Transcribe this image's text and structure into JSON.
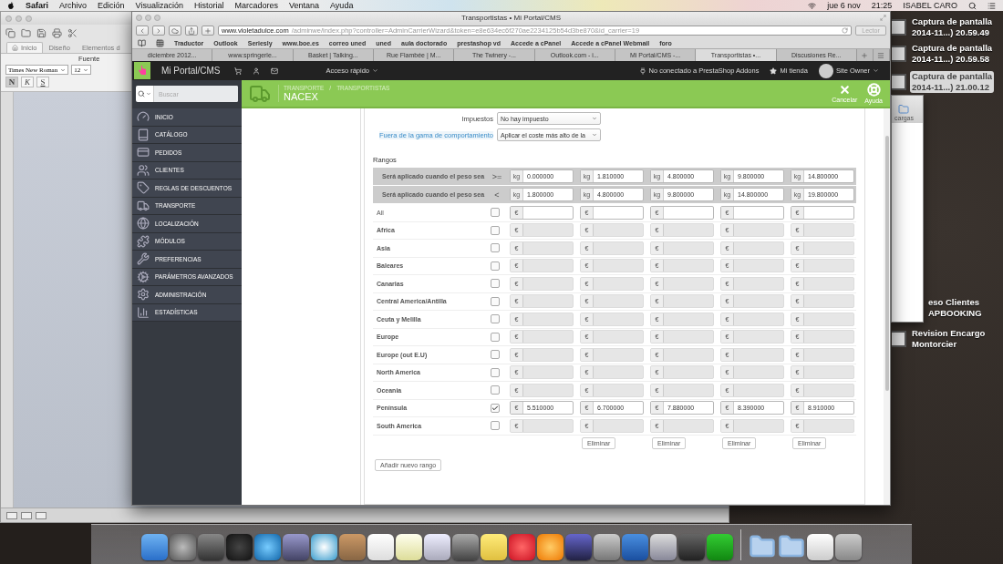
{
  "menubar": {
    "menus": [
      "Safari",
      "Archivo",
      "Edición",
      "Visualización",
      "Historial",
      "Marcadores",
      "Ventana",
      "Ayuda"
    ],
    "date": "jue 6 nov",
    "time": "21:25",
    "user": "ISABEL CARO"
  },
  "word_window": {
    "tabs": [
      {
        "label": "Inicio",
        "selected": true
      },
      {
        "label": "Diseño",
        "selected": false
      },
      {
        "label": "Elementos d",
        "selected": false
      }
    ],
    "group": "Fuente",
    "font": "Times New Roman",
    "size": "12",
    "styles": [
      "N",
      "K",
      "S"
    ]
  },
  "desktop_files": [
    {
      "name": "Captura de pantalla",
      "detail": "2014-11...) 20.59.49",
      "selected": false
    },
    {
      "name": "Captura de pantalla",
      "detail": "2014-11...) 20.59.58",
      "selected": false
    },
    {
      "name": "Captura de pantalla",
      "detail": "2014-11...) 21.00.12",
      "selected": true
    },
    {
      "name": "eso Clientes",
      "detail": "APBOOKING",
      "selected": false
    },
    {
      "name": "Revision Encargo",
      "detail": "Montorcier",
      "selected": false
    }
  ],
  "finder_window": {
    "item": "cargas"
  },
  "browser": {
    "title": "Transportistas • Mi Portal/CMS",
    "url_host": "www.violetadulce.com",
    "url_path": "/adminwe/index.php?controller=AdminCarrierWizard&token=e8e634ec6f270ae2234125b54d3be870&id_carrier=19",
    "reader": "Lector",
    "bookmarks": [
      "Traductor",
      "Outlook",
      "Seriesly",
      "www.boe.es",
      "correo uned",
      "uned",
      "aula doctorado",
      "prestashop vd",
      "Accede a cPanel",
      "Accede a cPanel Webmail",
      "foro"
    ],
    "tabs": [
      {
        "label": "diciembre 2012...",
        "selected": false
      },
      {
        "label": "www.springerle...",
        "selected": false
      },
      {
        "label": "Basket | Talking...",
        "selected": false
      },
      {
        "label": "Rue Flambée | M...",
        "selected": false
      },
      {
        "label": "The Twinery -...",
        "selected": false
      },
      {
        "label": "Outlook.com - i...",
        "selected": false
      },
      {
        "label": "Mi Portal/CMS -...",
        "selected": false
      },
      {
        "label": "Transportistas •...",
        "selected": true
      },
      {
        "label": "Discusiones Re...",
        "selected": false
      }
    ]
  },
  "admin": {
    "site": "Mi Portal/CMS",
    "quick_access": "Acceso rápido",
    "addons": "No conectado a PrestaShop Addons",
    "shop": "Mi tienda",
    "user": "Site Owner",
    "search_placeholder": "Buscar",
    "menu": [
      "INICIO",
      "CATÁLOGO",
      "PEDIDOS",
      "CLIENTES",
      "REGLAS DE DESCUENTOS",
      "TRANSPORTE",
      "LOCALIZACIÓN",
      "MÓDULOS",
      "PREFERENCIAS",
      "PARÁMETROS AVANZADOS",
      "ADMINISTRACIÓN",
      "ESTADÍSTICAS"
    ],
    "breadcrumb": [
      "TRANSPORTE",
      "TRANSPORTISTAS"
    ],
    "breadcrumb_separator": "/",
    "title": "NACEX",
    "actions": [
      "Cancelar",
      "Ayuda"
    ],
    "form": {
      "tax_label": "Impuestos",
      "tax_value": "No hay impuesto",
      "range_label": "Fuera de la gama de comportamiento",
      "range_value": "Aplicar el coste más alto de la",
      "ranges_title": "Rangos",
      "bounds": [
        {
          "label": "Será aplicado cuando el peso sea",
          "op": ">=",
          "cells": [
            {
              "unit": "kg",
              "value": "0.000000"
            },
            {
              "unit": "kg",
              "value": "1.810000"
            },
            {
              "unit": "kg",
              "value": "4.800000"
            },
            {
              "unit": "kg",
              "value": "9.800000"
            },
            {
              "unit": "kg",
              "value": "14.800000"
            }
          ]
        },
        {
          "label": "Será aplicado cuando el peso sea",
          "op": "<",
          "cells": [
            {
              "unit": "kg",
              "value": "1.800000"
            },
            {
              "unit": "kg",
              "value": "4.800000"
            },
            {
              "unit": "kg",
              "value": "9.800000"
            },
            {
              "unit": "kg",
              "value": "14.800000"
            },
            {
              "unit": "kg",
              "value": "19.800000"
            }
          ]
        }
      ],
      "zones": [
        {
          "name": "All",
          "kind": "all",
          "checked": false,
          "disabled": false,
          "cells": [
            {
              "unit": "€"
            },
            {
              "unit": "€"
            },
            {
              "unit": "€"
            },
            {
              "unit": "€"
            },
            {
              "unit": "€"
            }
          ]
        },
        {
          "name": "Africa",
          "kind": "zone",
          "checked": false,
          "disabled": true,
          "cells": [
            {
              "unit": "€"
            },
            {
              "unit": "€"
            },
            {
              "unit": "€"
            },
            {
              "unit": "€"
            },
            {
              "unit": "€"
            }
          ]
        },
        {
          "name": "Asia",
          "kind": "zone",
          "checked": false,
          "disabled": true,
          "cells": [
            {
              "unit": "€"
            },
            {
              "unit": "€"
            },
            {
              "unit": "€"
            },
            {
              "unit": "€"
            },
            {
              "unit": "€"
            }
          ]
        },
        {
          "name": "Baleares",
          "kind": "zone",
          "checked": false,
          "disabled": true,
          "cells": [
            {
              "unit": "€"
            },
            {
              "unit": "€"
            },
            {
              "unit": "€"
            },
            {
              "unit": "€"
            },
            {
              "unit": "€"
            }
          ]
        },
        {
          "name": "Canarias",
          "kind": "zone",
          "checked": false,
          "disabled": true,
          "cells": [
            {
              "unit": "€"
            },
            {
              "unit": "€"
            },
            {
              "unit": "€"
            },
            {
              "unit": "€"
            },
            {
              "unit": "€"
            }
          ]
        },
        {
          "name": "Central America/Antilla",
          "kind": "zone",
          "checked": false,
          "disabled": true,
          "cells": [
            {
              "unit": "€"
            },
            {
              "unit": "€"
            },
            {
              "unit": "€"
            },
            {
              "unit": "€"
            },
            {
              "unit": "€"
            }
          ]
        },
        {
          "name": "Ceuta y Melilla",
          "kind": "zone",
          "checked": false,
          "disabled": true,
          "cells": [
            {
              "unit": "€"
            },
            {
              "unit": "€"
            },
            {
              "unit": "€"
            },
            {
              "unit": "€"
            },
            {
              "unit": "€"
            }
          ]
        },
        {
          "name": "Europe",
          "kind": "zone",
          "checked": false,
          "disabled": true,
          "cells": [
            {
              "unit": "€"
            },
            {
              "unit": "€"
            },
            {
              "unit": "€"
            },
            {
              "unit": "€"
            },
            {
              "unit": "€"
            }
          ]
        },
        {
          "name": "Europe (out E.U)",
          "kind": "zone",
          "checked": false,
          "disabled": true,
          "cells": [
            {
              "unit": "€"
            },
            {
              "unit": "€"
            },
            {
              "unit": "€"
            },
            {
              "unit": "€"
            },
            {
              "unit": "€"
            }
          ]
        },
        {
          "name": "North America",
          "kind": "zone",
          "checked": false,
          "disabled": true,
          "cells": [
            {
              "unit": "€"
            },
            {
              "unit": "€"
            },
            {
              "unit": "€"
            },
            {
              "unit": "€"
            },
            {
              "unit": "€"
            }
          ]
        },
        {
          "name": "Oceania",
          "kind": "zone",
          "checked": false,
          "disabled": true,
          "cells": [
            {
              "unit": "€"
            },
            {
              "unit": "€"
            },
            {
              "unit": "€"
            },
            {
              "unit": "€"
            },
            {
              "unit": "€"
            }
          ]
        },
        {
          "name": "Península",
          "kind": "zone",
          "checked": true,
          "disabled": false,
          "cells": [
            {
              "unit": "€",
              "value": "5.510000"
            },
            {
              "unit": "€",
              "value": "6.700000"
            },
            {
              "unit": "€",
              "value": "7.880000"
            },
            {
              "unit": "€",
              "value": "8.390000"
            },
            {
              "unit": "€",
              "value": "8.910000"
            }
          ]
        },
        {
          "name": "South America",
          "kind": "zone",
          "checked": false,
          "disabled": true,
          "cells": [
            {
              "unit": "€"
            },
            {
              "unit": "€"
            },
            {
              "unit": "€"
            },
            {
              "unit": "€"
            },
            {
              "unit": "€"
            }
          ]
        }
      ],
      "delete_buttons": [
        "Eliminar",
        "Eliminar",
        "Eliminar",
        "Eliminar"
      ],
      "add_button": "Añadir nuevo rango"
    }
  }
}
